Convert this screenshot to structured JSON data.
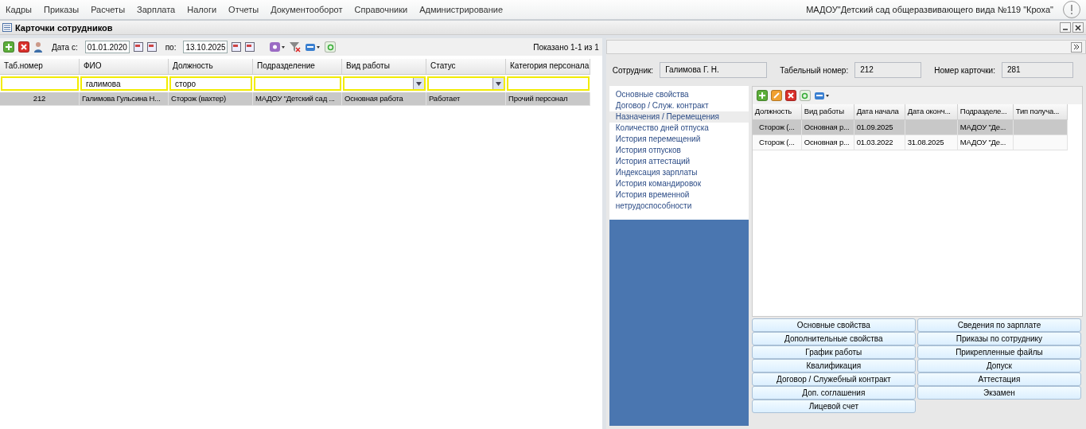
{
  "menu": {
    "items": [
      "Кадры",
      "Приказы",
      "Расчеты",
      "Зарплата",
      "Налоги",
      "Отчеты",
      "Документооборот",
      "Справочники",
      "Администрирование"
    ],
    "organization": "МАДОУ\"Детский сад общеразвивающего вида №119 \"Кроха\""
  },
  "panel": {
    "title": "Карточки сотрудников"
  },
  "toolbar": {
    "date_from_label": "Дата с:",
    "date_from": "01.01.2020",
    "date_to_label": "по:",
    "date_to": "13.10.2025",
    "shown": "Показано 1-1 из 1"
  },
  "grid": {
    "columns": [
      "Таб.номер",
      "ФИО",
      "Должность",
      "Подразделение",
      "Вид работы",
      "Статус",
      "Категория персонала"
    ],
    "filters": [
      {
        "kind": "text"
      },
      {
        "kind": "text",
        "value": "галимова"
      },
      {
        "kind": "text",
        "value": "сторо"
      },
      {
        "kind": "text"
      },
      {
        "kind": "select"
      },
      {
        "kind": "select"
      },
      {
        "kind": "text"
      }
    ],
    "rows": [
      {
        "selected": true,
        "cells": [
          "212",
          "Галимова Гульсина Н...",
          "Сторож (вахтер)",
          "МАДОУ \"Детский сад ...",
          "Основная работа",
          "Работает",
          "Прочий персонал"
        ]
      }
    ]
  },
  "card": {
    "employee_label": "Сотрудник:",
    "employee": "Галимова Г. Н.",
    "tab_number_label": "Табельный номер:",
    "tab_number": "212",
    "card_number_label": "Номер карточки:",
    "card_number": "281"
  },
  "nav": [
    {
      "label": "Основные свойства",
      "selected": false
    },
    {
      "label": "Договор / Служ. контракт",
      "selected": false
    },
    {
      "label": "Назначения / Перемещения",
      "selected": true
    },
    {
      "label": "Количество дней отпуска",
      "selected": false
    },
    {
      "label": "История перемещений",
      "selected": false
    },
    {
      "label": "История отпусков",
      "selected": false
    },
    {
      "label": "История аттестаций",
      "selected": false
    },
    {
      "label": "Индексация зарплаты",
      "selected": false
    },
    {
      "label": "История командировок",
      "selected": false
    },
    {
      "label": "История временной нетрудоспособности",
      "selected": false
    }
  ],
  "assignments": {
    "columns": [
      "Должность",
      "Вид работы",
      "Дата начала",
      "Дата оконч...",
      "Подразделе...",
      "Тип получа..."
    ],
    "rows": [
      {
        "selected": true,
        "cells": [
          "Сторож (...",
          "Основная р...",
          "01.09.2025",
          "",
          "МАДОУ \"Де...",
          ""
        ]
      },
      {
        "selected": false,
        "cells": [
          "Сторож (...",
          "Основная р...",
          "01.03.2022",
          "31.08.2025",
          "МАДОУ \"Де...",
          ""
        ]
      }
    ]
  },
  "buttons": [
    "Основные свойства",
    "Сведения по зарплате",
    "Дополнительные свойства",
    "Приказы по сотруднику",
    "График работы",
    "Прикрепленные файлы",
    "Квалификация",
    "Допуск",
    "Договор / Служебный контракт",
    "Аттестация",
    "Доп. соглашения",
    "Экзамен",
    "Лицевой счет"
  ]
}
